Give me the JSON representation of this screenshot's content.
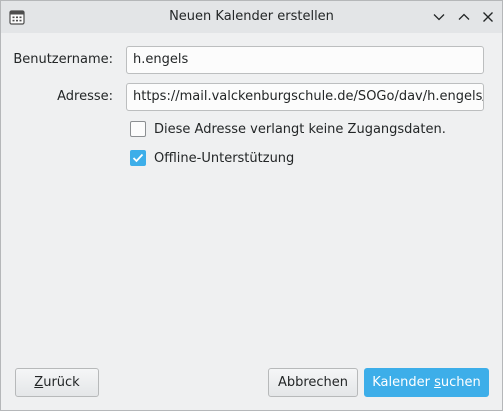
{
  "window": {
    "title": "Neuen Kalender erstellen"
  },
  "form": {
    "username_label": "Benutzername:",
    "username_value": "h.engels",
    "address_label": "Adresse:",
    "address_value": "https://mail.valckenburgschule.de/SOGo/dav/h.engels/C",
    "no_credentials_label": "Diese Adresse verlangt keine Zugangsdaten.",
    "no_credentials_checked": false,
    "offline_label": "Offline-Unterstützung",
    "offline_checked": true
  },
  "buttons": {
    "back_prefix": "",
    "back_mnemonic": "Z",
    "back_rest": "urück",
    "cancel": "Abbrechen",
    "find_prefix": "Kalender ",
    "find_mnemonic": "s",
    "find_rest": "uchen"
  },
  "colors": {
    "accent": "#3daee9",
    "window_bg": "#eff0f1"
  }
}
